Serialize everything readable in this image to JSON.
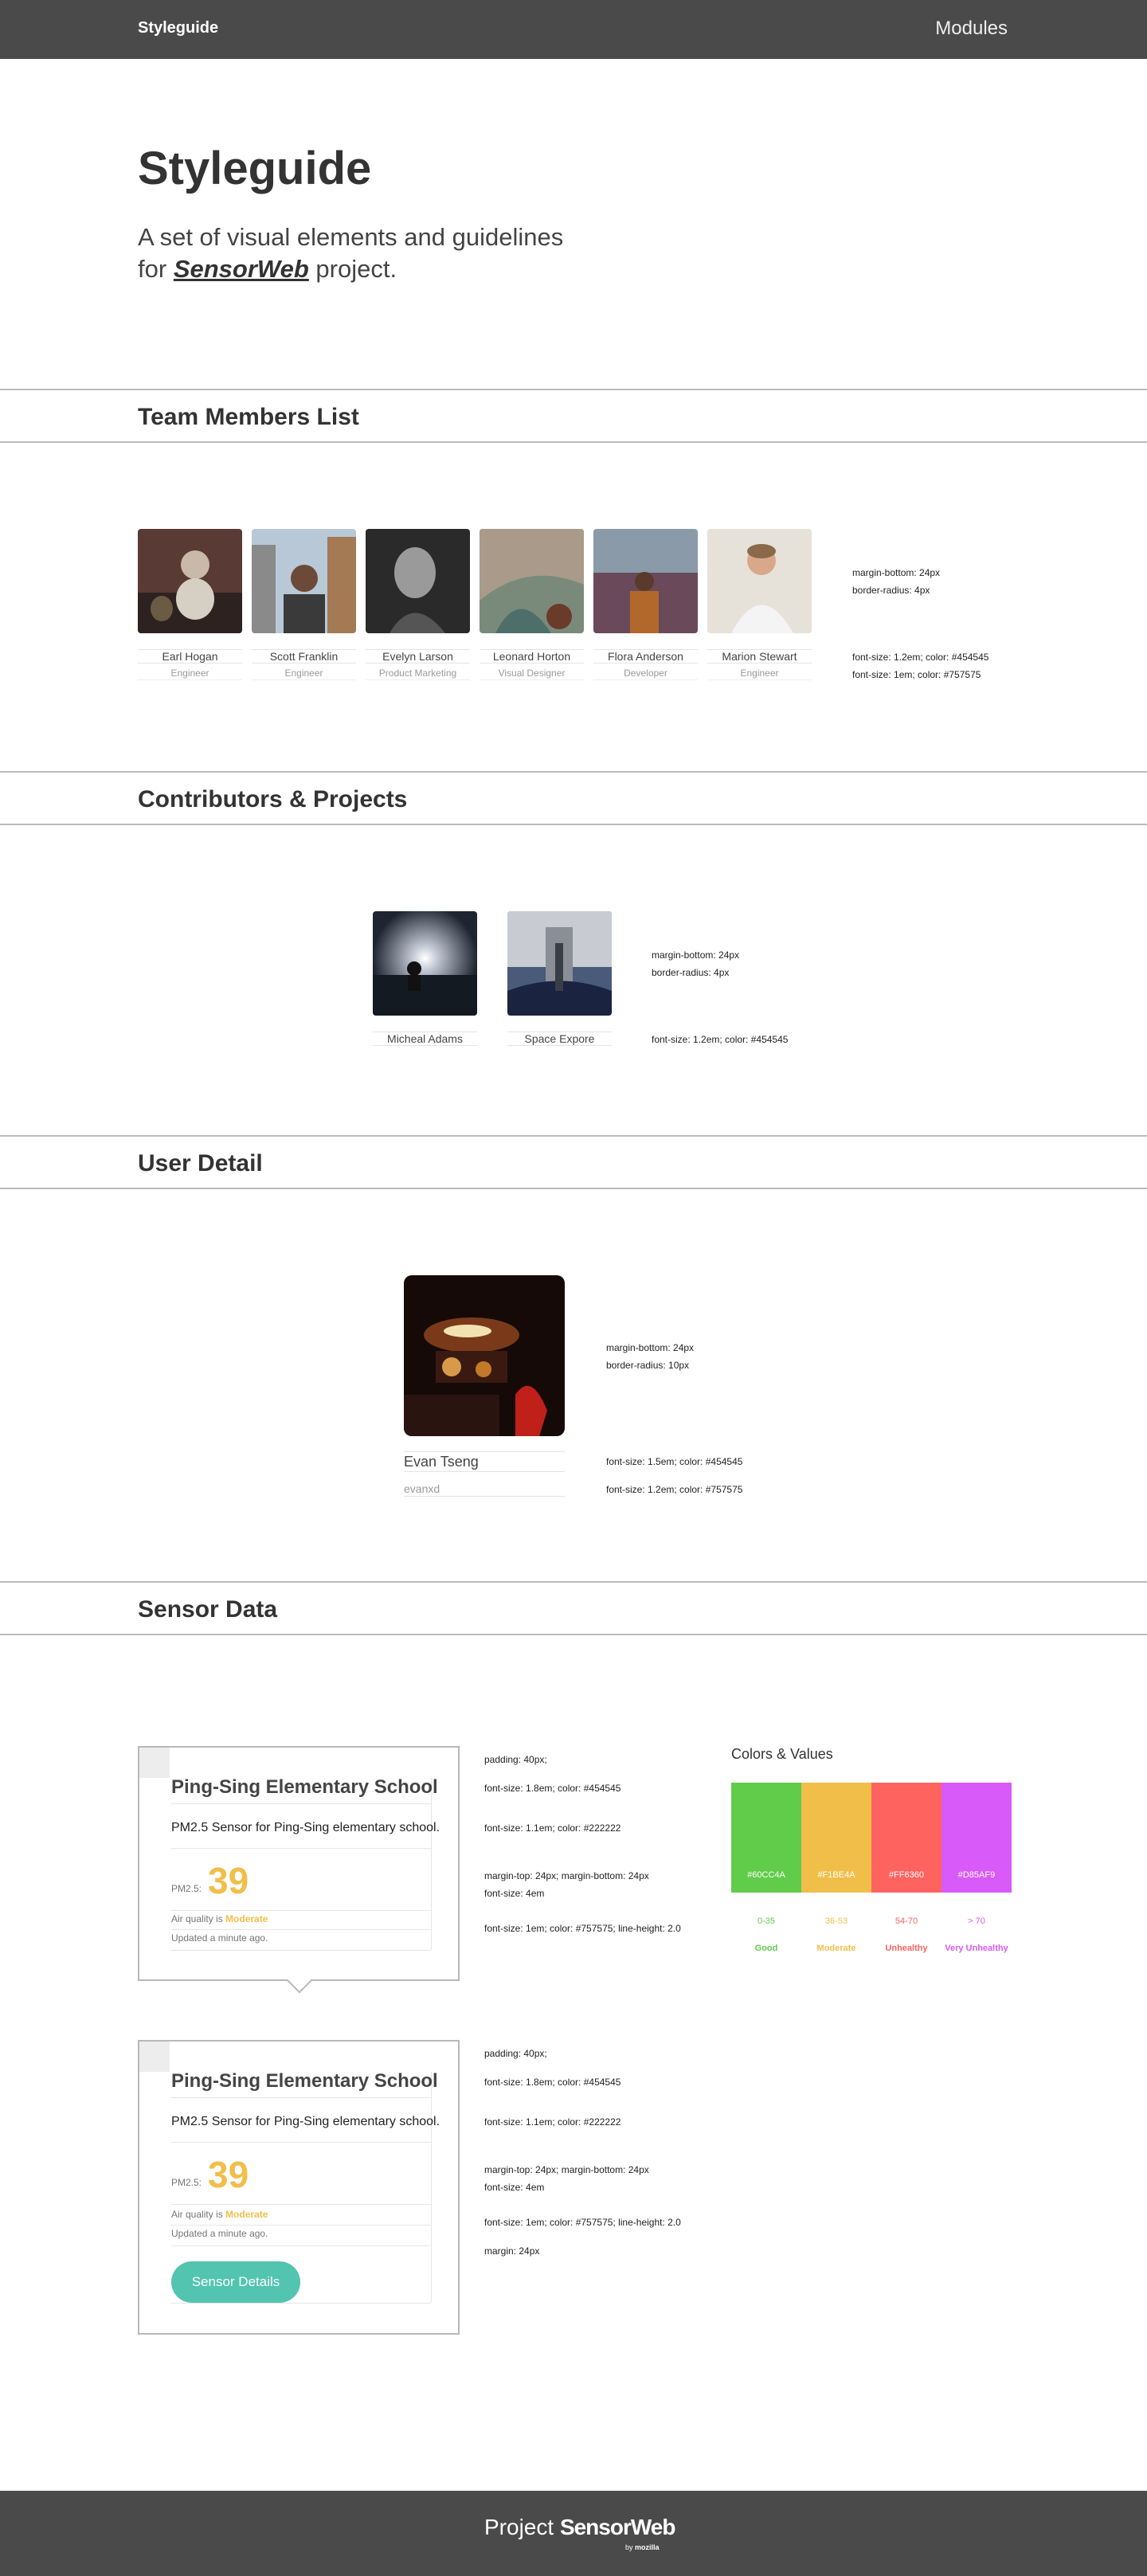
{
  "header": {
    "brand": "Styleguide",
    "nav_modules": "Modules"
  },
  "hero": {
    "title": "Styleguide",
    "subtitle_line1": "A set of visual elements and guidelines",
    "subtitle_for": "for",
    "project_link": "SensorWeb",
    "subtitle_end": "project."
  },
  "sections": {
    "team": "Team Members List",
    "contributors": "Contributors & Projects",
    "user": "User Detail",
    "sensor": "Sensor Data"
  },
  "team": {
    "members": [
      {
        "name": "Earl Hogan",
        "role": "Engineer"
      },
      {
        "name": "Scott Franklin",
        "role": "Engineer"
      },
      {
        "name": "Evelyn Larson",
        "role": "Product Marketing"
      },
      {
        "name": "Leonard Horton",
        "role": "Visual Designer"
      },
      {
        "name": "Flora Anderson",
        "role": "Developer"
      },
      {
        "name": "Marion Stewart",
        "role": "Engineer"
      }
    ],
    "notes": [
      "margin-bottom: 24px",
      "border-radius: 4px",
      "font-size: 1.2em; color: #454545",
      "font-size: 1em; color: #757575"
    ]
  },
  "contributors": {
    "items": [
      {
        "name": "Micheal Adams"
      },
      {
        "name": "Space Expore"
      }
    ],
    "notes": [
      "margin-bottom: 24px",
      "border-radius: 4px",
      "font-size: 1.2em; color: #454545"
    ]
  },
  "user": {
    "name": "Evan Tseng",
    "handle": "evanxd",
    "notes": [
      "margin-bottom: 24px",
      "border-radius: 10px",
      "font-size: 1.5em; color: #454545",
      "font-size: 1.2em; color: #757575"
    ]
  },
  "sensor": {
    "card": {
      "title": "Ping-Sing Elementary School",
      "description": "PM2.5 Sensor for Ping-Sing elementary school.",
      "pm_label": "PM2.5:",
      "pm_value": "39",
      "aq_prefix": "Air quality is",
      "aq_level": "Moderate",
      "updated": "Updated a minute ago.",
      "button": "Sensor Details"
    },
    "notes1": [
      "padding: 40px;",
      "font-size: 1.8em; color: #454545",
      "font-size: 1.1em; color: #222222",
      "margin-top: 24px; margin-bottom: 24px",
      "font-size: 4em",
      "font-size: 1em; color: #757575; line-height: 2.0"
    ],
    "notes2": [
      "padding: 40px;",
      "font-size: 1.8em; color: #454545",
      "font-size: 1.1em; color: #222222",
      "margin-top: 24px; margin-bottom: 24px",
      "font-size: 4em",
      "font-size: 1em; color: #757575; line-height: 2.0",
      "margin: 24px"
    ],
    "colors": {
      "title": "Colors & Values",
      "items": [
        {
          "hex": "#60CC4A",
          "range": "0-35",
          "level": "Good"
        },
        {
          "hex": "#F1BE4A",
          "range": "36-53",
          "level": "Moderate"
        },
        {
          "hex": "#FF6360",
          "range": "54-70",
          "level": "Unhealthy"
        },
        {
          "hex": "#D85AF9",
          "range": "> 70",
          "level": "Very Unhealthy"
        }
      ]
    }
  },
  "footer": {
    "logo_prefix": "Project",
    "logo_name": "SensorWeb",
    "by_prefix": "by",
    "by_name": "mozilla"
  }
}
